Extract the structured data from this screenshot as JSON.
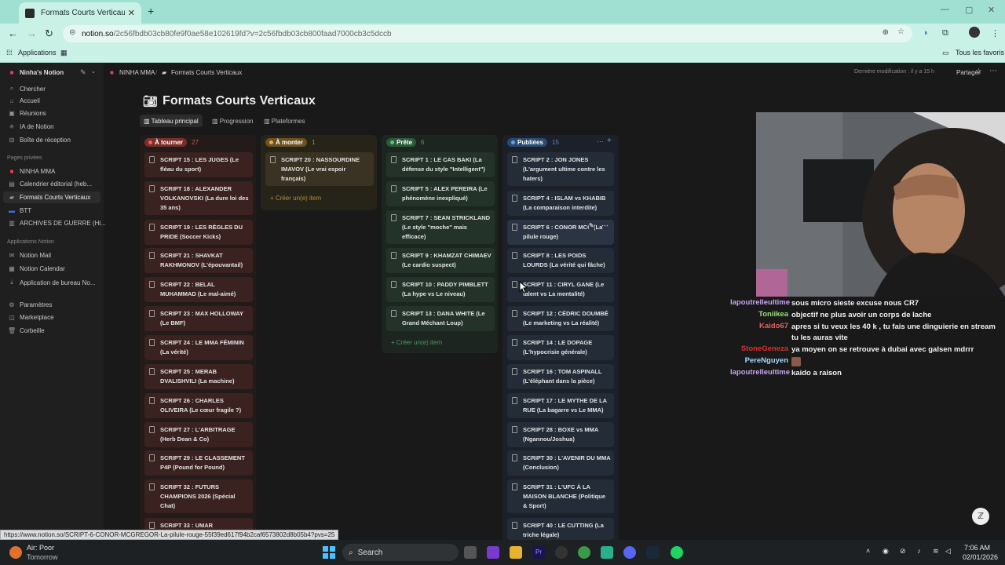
{
  "browser": {
    "tab_title": "Formats Courts Verticaux | Table",
    "url_domain": "notion.so",
    "url_path": "/2c56fbdb03cb80fe9f0ae58e102619fd?v=2c56fbdb03cb800faad7000cb3c5dccb",
    "bookmarks": {
      "apps": "Applications",
      "all": "Tous les favoris"
    }
  },
  "sidebar": {
    "workspace": "Ninha's Notion",
    "items": [
      {
        "label": "Chercher",
        "icon": "search-icon"
      },
      {
        "label": "Accueil",
        "icon": "home-icon"
      },
      {
        "label": "Réunions",
        "icon": "meetings-icon"
      },
      {
        "label": "IA de Notion",
        "icon": "ai-icon"
      },
      {
        "label": "Boîte de réception",
        "icon": "inbox-icon"
      }
    ],
    "private_heading": "Pages privées",
    "private_pages": [
      {
        "label": "NINHA MMA"
      },
      {
        "label": "Calendrier éditorial (heb..."
      },
      {
        "label": "Formats Courts Verticaux"
      },
      {
        "label": "BTT"
      },
      {
        "label": "ARCHIVES DE GUERRE (Hi..."
      }
    ],
    "apps_heading": "Applications Notion",
    "apps": [
      {
        "label": "Notion Mail"
      },
      {
        "label": "Notion Calendar"
      },
      {
        "label": "Application de bureau No..."
      }
    ],
    "bottom": [
      {
        "label": "Paramètres"
      },
      {
        "label": "Marketplace"
      },
      {
        "label": "Corbeille"
      }
    ]
  },
  "topbar": {
    "crumb1": "NINHA MMA",
    "crumb2": "Formats Courts Verticaux",
    "last_modified": "Dernière modification : il y a 15 h",
    "share": "Partager"
  },
  "page": {
    "title": "Formats Courts Verticaux",
    "views": [
      "Tableau principal",
      "Progression",
      "Plateformes"
    ]
  },
  "board": {
    "create_label": "Créer un(e) item",
    "columns": [
      {
        "name": "À tourner",
        "count": "27",
        "pill": "#b5403a",
        "count_color": "#c05a50",
        "cards": [
          "SCRIPT 15 : LES JUGES (Le fléau du sport)",
          "SCRIPT 18 : ALEXANDER VOLKANOVSKI (La dure loi des 35 ans)",
          "SCRIPT 19 : LES RÈGLES DU PRIDE (Soccer Kicks)",
          "SCRIPT 21 : SHAVKAT RAKHMONOV (L'épouvantail)",
          "SCRIPT 22 : BELAL MUHAMMAD (Le mal-aimé)",
          "SCRIPT 23 : MAX HOLLOWAY (Le BMF)",
          "SCRIPT 24 : LE MMA FÉMININ (La vérité)",
          "SCRIPT 25 : MERAB DVALISHVILI (La machine)",
          "SCRIPT 26 : CHARLES OLIVEIRA (Le cœur fragile ?)",
          "SCRIPT 27 : L'ARBITRAGE (Herb Dean & Co)",
          "SCRIPT 29 : LE CLASSEMENT P4P (Pound for Pound)",
          "SCRIPT 32 : FUTURS CHAMPIONS 2026 (Spécial Chat)",
          "SCRIPT 33 : UMAR"
        ]
      },
      {
        "name": "À monter",
        "count": "1",
        "pill": "#8a6a2a",
        "count_color": "#b8913a",
        "cards": [
          "SCRIPT 20 : NASSOURDINE IMAVOV (Le vrai espoir français)"
        ]
      },
      {
        "name": "Prête",
        "count": "6",
        "pill": "#2f6b45",
        "count_color": "#4f9a68",
        "cards": [
          "SCRIPT 1 : LE CAS BAKI (La défense du style \"Intelligent\")",
          "SCRIPT 5 : ALEX PEREIRA (Le phénomène inexpliqué)",
          "SCRIPT 7 : SEAN STRICKLAND (Le style \"moche\" mais efficace)",
          "SCRIPT 9 : KHAMZAT CHIMAEV (Le cardio suspect)",
          "SCRIPT 10 : PADDY PIMBLETT (La hype vs Le niveau)",
          "SCRIPT 13 : DANA WHITE (Le Grand Méchant Loup)"
        ]
      },
      {
        "name": "Publiées",
        "count": "15",
        "pill": "#2d5a8a",
        "count_color": "#5a8ac0",
        "cards": [
          "SCRIPT 2 : JON JONES (L'argument ultime contre les haters)",
          "SCRIPT 4 : ISLAM vs KHABIB (La comparaison interdite)",
          "SCRIPT 6 : CONOR MCG (La pilule rouge)",
          "SCRIPT 8 : LES POIDS LOURDS (La vérité qui fâche)",
          "SCRIPT 11 : CIRYL GANE (Le talent vs La mentalité)",
          "SCRIPT 12 : CÉDRIC DOUMBÉ (Le marketing vs La réalité)",
          "SCRIPT 14 : LE DOPAGE (L'hypocrisie générale)",
          "SCRIPT 16 : TOM ASPINALL (L'éléphant dans la pièce)",
          "SCRIPT 17 : LE MYTHE DE LA RUE (La bagarre vs Le MMA)",
          "SCRIPT 28 : BOXE vs MMA (Ngannou/Joshua)",
          "SCRIPT 30 : L'AVENIR DU MMA (Conclusion)",
          "SCRIPT 31 : L'UFC À LA MAISON BLANCHE (Politique & Sport)",
          "SCRIPT 40 : LE CUTTING (La triche légale)"
        ]
      }
    ]
  },
  "chat": [
    {
      "user": "lapoutrelleultime",
      "color": "#c8a4f0",
      "msg": "sous micro sieste excuse nous CR7"
    },
    {
      "user": "Toniikea",
      "color": "#9ae07a",
      "msg": "objectif ne plus avoir un corps de lache"
    },
    {
      "user": "Kaido67",
      "color": "#e06060",
      "msg": "apres si tu veux les 40 k , tu fais une dinguierie en stream tu les auras vite"
    },
    {
      "user": "StoneGeneza",
      "color": "#d83030",
      "msg": "ya moyen on se retrouve à dubai avec galsen mdrrr"
    },
    {
      "user": "PereNguyen",
      "color": "#a6d8ff",
      "msg": ""
    },
    {
      "user": "lapoutrelleultime",
      "color": "#c8a4f0",
      "msg": "kaido a raison"
    }
  ],
  "status_url": "https://www.notion.so/SCRIPT-6-CONOR-MCGREGOR-La-pilule-rouge-55f39ed617f94b2caf6573802d8b05b4?pvs=25",
  "taskbar": {
    "weather_title": "Air: Poor",
    "weather_sub": "Tomorrow",
    "search": "Search",
    "time": "7:06 AM",
    "date": "02/01/2026"
  }
}
